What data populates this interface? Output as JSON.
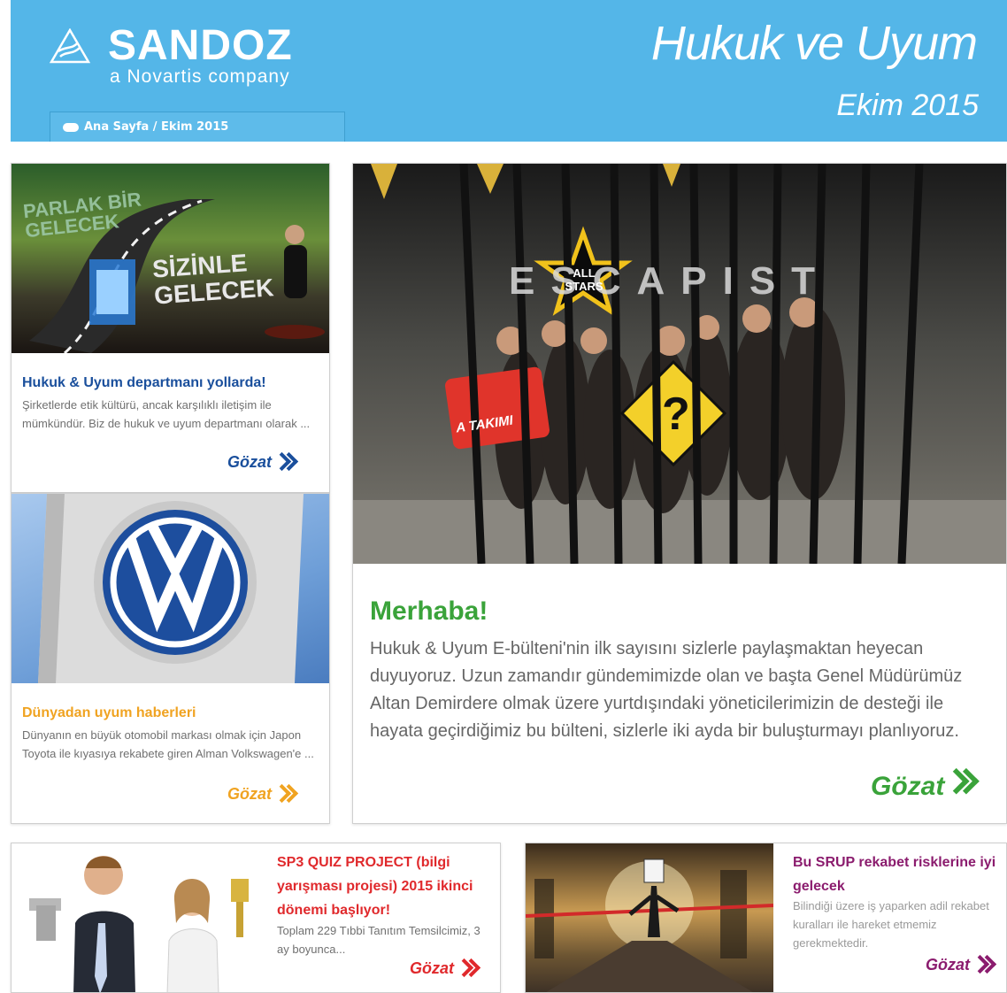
{
  "header": {
    "brand": "SANDOZ",
    "brand_sub": "a Novartis company",
    "title": "Hukuk ve Uyum",
    "date": "Ekim 2015",
    "breadcrumb": "Ana Sayfa / Ekim 2015"
  },
  "colors": {
    "header_bg": "#54b6e8",
    "blue_title": "#1a4f9c",
    "orange": "#f0a321",
    "green": "#3aa33a",
    "red": "#e0292c",
    "purple": "#8b1c6e"
  },
  "cards": {
    "hukuk": {
      "image_text_1": "PARLAK BİR GELECEK",
      "image_text_2": "SİZİNLE GELECEK",
      "title": "Hukuk & Uyum departmanı yollarda!",
      "text": "Şirketlerde etik kültürü, ancak karşılıklı iletişim ile mümkündür. Biz de hukuk ve uyum departmanı olarak ...",
      "more": "Gözat"
    },
    "dunya": {
      "title": "Dünyadan uyum haberleri",
      "text": "Dünyanın en büyük otomobil markası olmak için Japon Toyota ile kıyasıya rekabete giren Alman Volkswagen'e ...",
      "more": "Gözat"
    },
    "merhaba": {
      "image_sign": "ESCAPIST",
      "image_star": "ALL STARS",
      "image_team": "A TAKIMI",
      "title": "Merhaba!",
      "text": "Hukuk & Uyum E-bülteni'nin ilk sayısını sizlerle paylaşmaktan heyecan duyuyoruz. Uzun zamandır gündemimizde olan ve başta Genel Müdürümüz Altan Demirdere olmak üzere yurtdışındaki yöneticilerimizin de desteği ile hayata geçirdiğimiz bu bülteni, sizlerle iki ayda bir buluşturmayı planlıyoruz.",
      "more": "Gözat"
    },
    "sp3": {
      "title": "SP3 QUIZ PROJECT (bilgi yarışması projesi) 2015 ikinci dönemi başlıyor!",
      "text": "Toplam 229 Tıbbi Tanıtım Temsilcimiz, 3 ay boyunca...",
      "more": "Gözat"
    },
    "srup": {
      "title": "Bu SRUP rekabet risklerine iyi gelecek",
      "text": "Bilindiği üzere iş yaparken adil rekabet kuralları ile hareket etmemiz gerekmektedir.",
      "more": "Gözat"
    }
  }
}
